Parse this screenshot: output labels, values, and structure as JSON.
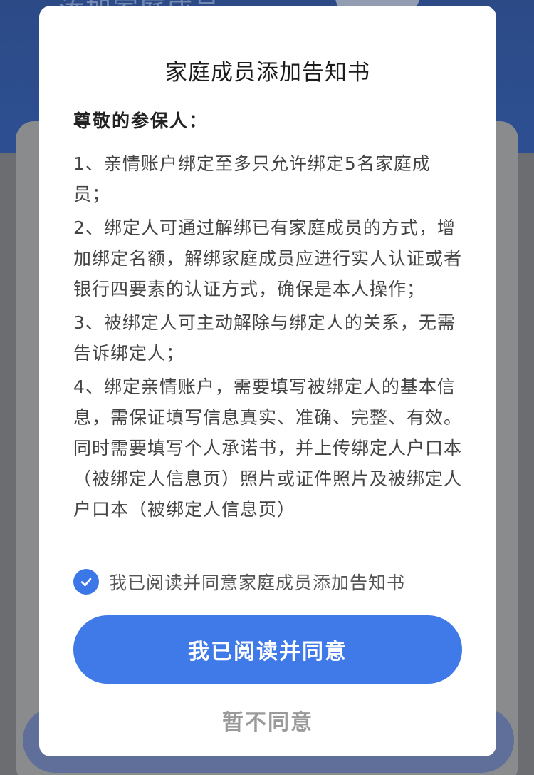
{
  "background": {
    "header_text": "添加家庭成员",
    "header_color": "#2c4a86"
  },
  "dialog": {
    "title": "家庭成员添加告知书",
    "salutation": "尊敬的参保人：",
    "clauses": [
      "1、亲情账户绑定至多只允许绑定5名家庭成员；",
      "2、绑定人可通过解绑已有家庭成员的方式，增加绑定名额，解绑家庭成员应进行实人认证或者银行四要素的认证方式，确保是本人操作；",
      "3、被绑定人可主动解除与绑定人的关系，无需告诉绑定人；",
      "4、绑定亲情账户，需要填写被绑定人的基本信息，需保证填写信息真实、准确、完整、有效。同时需要填写个人承诺书，并上传绑定人户口本（被绑定人信息页）照片或证件照片及被绑定人户口本（被绑定人信息页）"
    ],
    "agree_checkbox": {
      "checked": true,
      "label": "我已阅读并同意家庭成员添加告知书",
      "icon": "check-icon"
    },
    "primary_button": "我已阅读并同意",
    "secondary_button": "暂不同意"
  },
  "colors": {
    "accent": "#3f7ae8",
    "text": "#444444",
    "muted": "#9a9a9a"
  }
}
